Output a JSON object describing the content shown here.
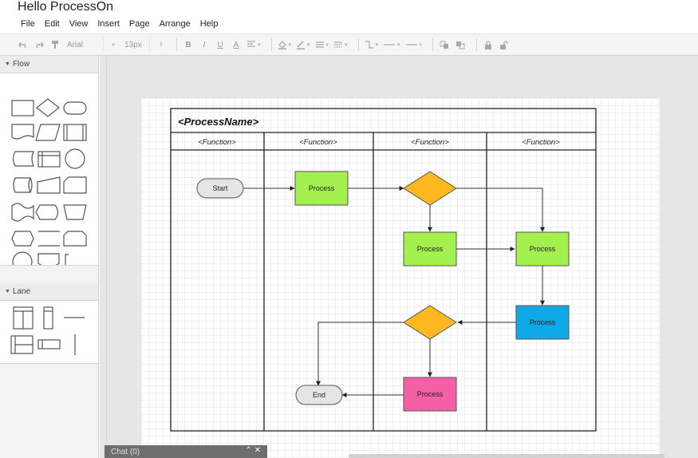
{
  "app": {
    "title": "Hello ProcessOn"
  },
  "menu": [
    "File",
    "Edit",
    "View",
    "Insert",
    "Page",
    "Arrange",
    "Help"
  ],
  "toolbar": {
    "font": "Arial",
    "font_size": "13px",
    "bold": "B",
    "italic": "I",
    "underline": "U",
    "font_color": "A"
  },
  "sidebar": {
    "sections": [
      {
        "title": "Flow"
      },
      {
        "title": "Lane"
      }
    ]
  },
  "diagram": {
    "pool_title": "<ProcessName>",
    "lanes": [
      "<Function>",
      "<Function>",
      "<Function>",
      "<Function>"
    ],
    "nodes": {
      "start": "Start",
      "process1": "Process",
      "process2": "Process",
      "process3": "Process",
      "process4": "Process",
      "process5": "Process",
      "end": "End"
    },
    "colors": {
      "green": "#a4f04f",
      "orange": "#ffb81f",
      "blue": "#0ea9e6",
      "pink": "#f55fa8",
      "terminal": "#e5e5e5"
    }
  },
  "chat": {
    "label": "Chat (0)"
  }
}
